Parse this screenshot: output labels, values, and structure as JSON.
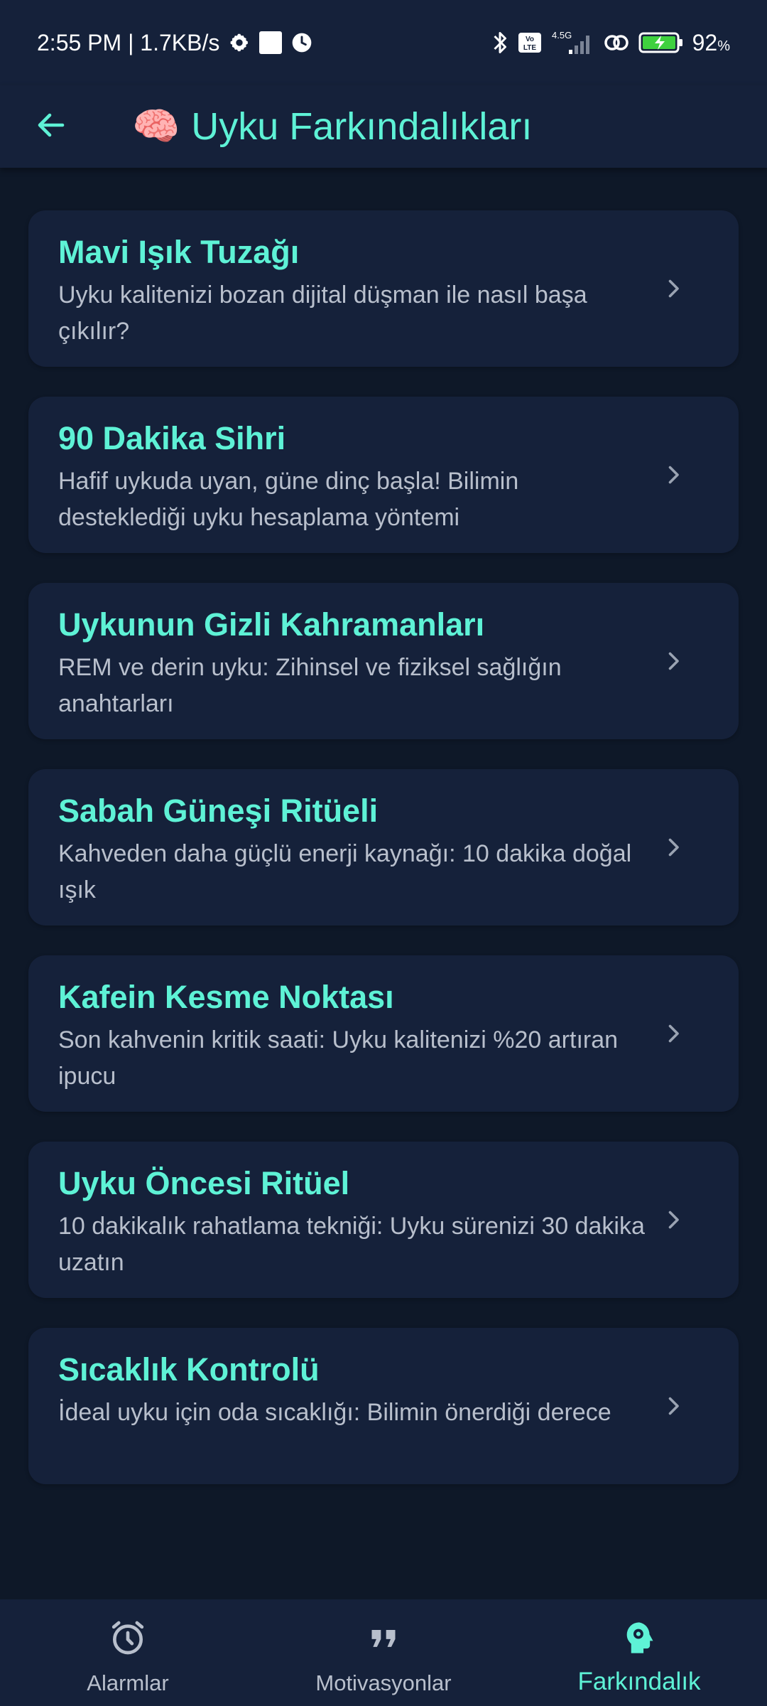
{
  "status_bar": {
    "time_speed": "2:55 PM | 1.7KB/s",
    "network_type": "4.5G",
    "volte": "Vo LTE",
    "battery": "92",
    "battery_unit": "%"
  },
  "app_bar": {
    "title": "Uyku Farkındalıkları",
    "title_emoji": "🧠"
  },
  "cards": [
    {
      "title": "Mavi Işık Tuzağı",
      "description": "Uyku kalitenizi bozan dijital düşman ile nasıl başa çıkılır?"
    },
    {
      "title": "90 Dakika Sihri",
      "description": "Hafif uykuda uyan, güne dinç başla! Bilimin desteklediği uyku hesaplama yöntemi"
    },
    {
      "title": "Uykunun Gizli Kahramanları",
      "description": "REM ve derin uyku: Zihinsel ve fiziksel sağlığın anahtarları"
    },
    {
      "title": "Sabah Güneşi Ritüeli",
      "description": "Kahveden daha güçlü enerji kaynağı: 10 dakika doğal ışık"
    },
    {
      "title": "Kafein Kesme Noktası",
      "description": "Son kahvenin kritik saati: Uyku kalitenizi %20 artıran ipucu"
    },
    {
      "title": "Uyku Öncesi Ritüel",
      "description": "10 dakikalık rahatlama tekniği: Uyku sürenizi 30 dakika uzatın"
    },
    {
      "title": "Sıcaklık Kontrolü",
      "description": "İdeal uyku için oda sıcaklığı: Bilimin önerdiği derece"
    }
  ],
  "bottom_nav": {
    "items": [
      {
        "label": "Alarmlar",
        "icon": "alarm-clock-icon",
        "active": false
      },
      {
        "label": "Motivasyonlar",
        "icon": "quote-icon",
        "active": false
      },
      {
        "label": "Farkındalık",
        "icon": "head-gear-icon",
        "active": true
      }
    ]
  },
  "colors": {
    "background": "#0e1828",
    "surface": "#15213a",
    "accent": "#5ef2d6",
    "text_secondary": "#b8bfcc"
  }
}
